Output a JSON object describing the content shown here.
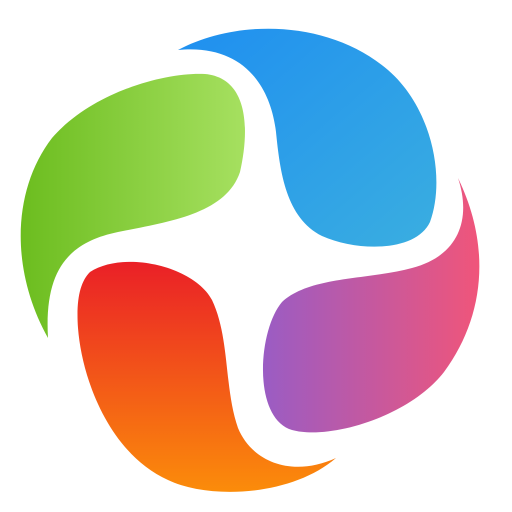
{
  "logo": {
    "name": "four-petal-pinwheel-logo",
    "background": "#ffffff",
    "petals": {
      "green": {
        "from": "#6cbd1f",
        "to": "#a6e060"
      },
      "blue": {
        "from": "#1f8ff0",
        "to": "#3aaee0"
      },
      "red_orange": {
        "from": "#ea2027",
        "to": "#fb8c0a"
      },
      "purple_pink": {
        "from": "#9a5cc4",
        "to": "#f0557a"
      }
    }
  }
}
